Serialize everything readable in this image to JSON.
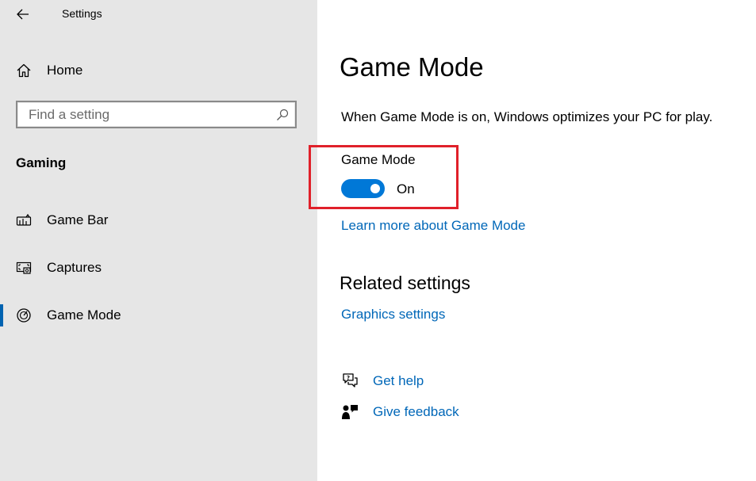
{
  "window": {
    "title": "Settings"
  },
  "sidebar": {
    "home_label": "Home",
    "search_placeholder": "Find a setting",
    "section_heading": "Gaming",
    "items": [
      {
        "label": "Game Bar",
        "icon": "game-bar-icon"
      },
      {
        "label": "Captures",
        "icon": "captures-icon"
      },
      {
        "label": "Game Mode",
        "icon": "game-mode-icon",
        "selected": true
      }
    ]
  },
  "main": {
    "title": "Game Mode",
    "description": "When Game Mode is on, Windows optimizes your PC for play.",
    "toggle": {
      "label": "Game Mode",
      "state_text": "On",
      "on": true
    },
    "learn_more_link": "Learn more about Game Mode",
    "related_title": "Related settings",
    "related_links": [
      "Graphics settings"
    ],
    "help": {
      "get_help": "Get help",
      "give_feedback": "Give feedback"
    }
  },
  "colors": {
    "accent": "#0078d7",
    "link": "#0067b8",
    "highlight": "#e0202a",
    "sidebar_bg": "#e6e6e6"
  }
}
